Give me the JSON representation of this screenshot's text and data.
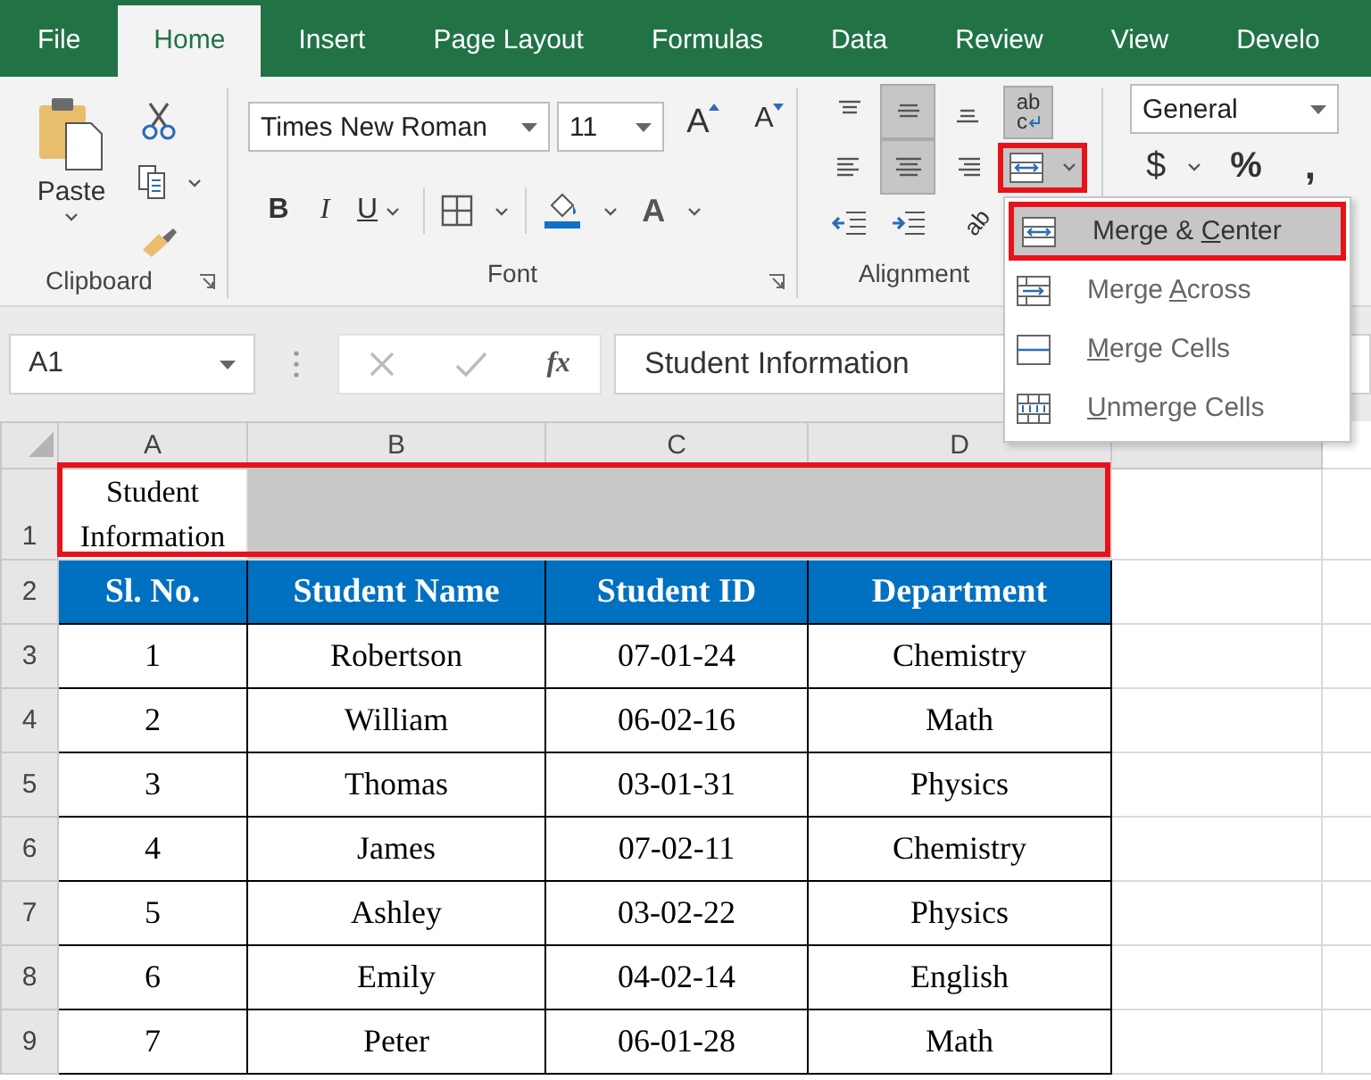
{
  "tabs": [
    {
      "label": "File",
      "selected": false
    },
    {
      "label": "Home",
      "selected": true
    },
    {
      "label": "Insert",
      "selected": false
    },
    {
      "label": "Page Layout",
      "selected": false
    },
    {
      "label": "Formulas",
      "selected": false
    },
    {
      "label": "Data",
      "selected": false
    },
    {
      "label": "Review",
      "selected": false
    },
    {
      "label": "View",
      "selected": false
    },
    {
      "label": "Develo",
      "selected": false
    }
  ],
  "ribbon": {
    "clipboard": {
      "paste_label": "Paste",
      "group_label": "Clipboard"
    },
    "font": {
      "font_name": "Times New Roman",
      "font_size": "11",
      "grow_glyph": "A",
      "shrink_glyph": "A",
      "bold_glyph": "B",
      "italic_glyph": "I",
      "underline_glyph": "U",
      "font_color_glyph": "A",
      "group_label": "Font"
    },
    "alignment": {
      "buttons": [
        {
          "kind": "top",
          "pressed": false
        },
        {
          "kind": "middle",
          "pressed": true
        },
        {
          "kind": "bottom",
          "pressed": false
        },
        {
          "kind": "left",
          "pressed": false
        },
        {
          "kind": "center",
          "pressed": true
        },
        {
          "kind": "right",
          "pressed": false
        }
      ],
      "wrap_text": {
        "glyph_top": "ab",
        "glyph_bottom": "c",
        "pressed": true
      },
      "merge_button": {
        "open": true,
        "annotated": true
      },
      "orientation_glyph": "ab",
      "group_label": "Alignment"
    },
    "number": {
      "format": "General",
      "currency_glyph": "$",
      "percent_glyph": "%",
      "comma_glyph": ","
    }
  },
  "merge_menu": {
    "items": [
      {
        "kind": "merge-center",
        "label_before": "Merge & ",
        "access_key": "C",
        "label_after": "enter",
        "selected": true,
        "annotated": true
      },
      {
        "kind": "merge-across",
        "label_before": "Merge ",
        "access_key": "A",
        "label_after": "cross",
        "selected": false,
        "annotated": false
      },
      {
        "kind": "merge-cells",
        "access_key": "M",
        "label_after": "erge Cells",
        "selected": false,
        "annotated": false
      },
      {
        "kind": "unmerge-cells",
        "access_key": "U",
        "label_after": "nmerge Cells",
        "selected": false,
        "annotated": false
      }
    ]
  },
  "formula_bar": {
    "name_box": "A1",
    "function_glyph": "fx",
    "formula": "Student Information"
  },
  "sheet": {
    "columns": [
      "A",
      "B",
      "C",
      "D"
    ],
    "row_numbers": [
      "1",
      "2",
      "3",
      "4",
      "5",
      "6",
      "7",
      "8",
      "9"
    ],
    "title_row": {
      "text": "Student Information",
      "selected": true,
      "annotated": true
    },
    "table": {
      "columns": [
        "Sl. No.",
        "Student Name",
        "Student ID",
        "Department"
      ],
      "rows": [
        [
          "1",
          "Robertson",
          "07-01-24",
          "Chemistry"
        ],
        [
          "2",
          "William",
          "06-02-16",
          "Math"
        ],
        [
          "3",
          "Thomas",
          "03-01-31",
          "Physics"
        ],
        [
          "4",
          "James",
          "07-02-11",
          "Chemistry"
        ],
        [
          "5",
          "Ashley",
          "03-02-22",
          "Physics"
        ],
        [
          "6",
          "Emily",
          "04-02-14",
          "English"
        ],
        [
          "7",
          "Peter",
          "06-01-28",
          "Math"
        ]
      ]
    }
  }
}
